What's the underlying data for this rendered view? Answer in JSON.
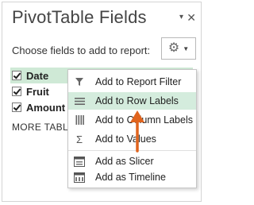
{
  "pane": {
    "title": "PivotTable Fields",
    "close_glyph": "✕",
    "caret_glyph": "▾",
    "instruction": "Choose fields to add to report:",
    "gear_glyph": "⚙",
    "gear_caret": "▼"
  },
  "fields": [
    {
      "label": "Date",
      "checked": true,
      "selected": true
    },
    {
      "label": "Fruit",
      "checked": true,
      "selected": false
    },
    {
      "label": "Amount",
      "checked": true,
      "selected": false
    }
  ],
  "field_dropdown_glyph": "▼",
  "more_tables": "MORE TABLES...",
  "menu": {
    "items": [
      {
        "label": "Add to Report Filter",
        "icon": "filter-icon"
      },
      {
        "label": "Add to Row Labels",
        "icon": "row-labels-icon",
        "highlighted": true
      },
      {
        "label": "Add to Column Labels",
        "icon": "column-labels-icon"
      },
      {
        "label": "Add to Values",
        "icon": "sigma-icon",
        "glyph": "Σ"
      },
      {
        "label": "Add as Slicer",
        "icon": "slicer-icon"
      },
      {
        "label": "Add as Timeline",
        "icon": "timeline-icon"
      }
    ]
  },
  "colors": {
    "selection": "#cfe9d6",
    "highlight": "#d4ecdd",
    "arrow": "#e0641e"
  }
}
